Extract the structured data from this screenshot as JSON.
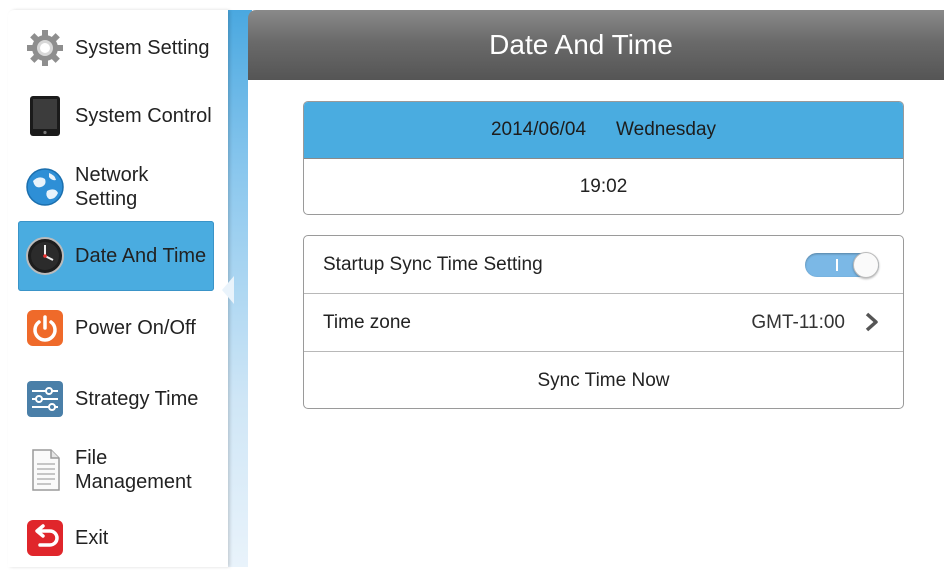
{
  "sidebar": {
    "items": [
      {
        "label": "System Setting",
        "icon": "gear-icon"
      },
      {
        "label": "System Control",
        "icon": "tablet-icon"
      },
      {
        "label": "Network Setting",
        "icon": "globe-icon"
      },
      {
        "label": "Date And Time",
        "icon": "clock-icon",
        "active": true
      },
      {
        "label": "Power On/Off",
        "icon": "power-icon"
      },
      {
        "label": "Strategy Time",
        "icon": "sliders-icon"
      },
      {
        "label": "File",
        "label2": "Management",
        "icon": "document-icon"
      },
      {
        "label": "Exit",
        "icon": "exit-icon"
      }
    ]
  },
  "header": {
    "title": "Date And Time"
  },
  "date_card": {
    "date": "2014/06/04",
    "weekday": "Wednesday",
    "time": "19:02"
  },
  "settings": {
    "startup_sync_label": "Startup Sync Time Setting",
    "startup_sync_on": true,
    "timezone_label": "Time zone",
    "timezone_value": "GMT-11:00",
    "sync_now_label": "Sync Time Now"
  },
  "colors": {
    "accent": "#4aace0",
    "header": "#666666"
  }
}
